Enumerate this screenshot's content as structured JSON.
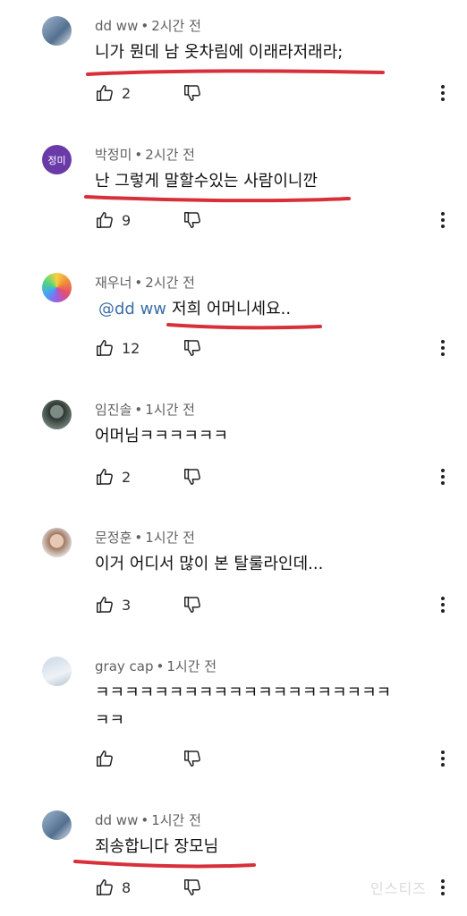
{
  "comments": [
    {
      "author": "dd ww",
      "time": "2시간 전",
      "text": "니가 뭔데 남 옷차림에 이래라저래라;",
      "mention": "",
      "likes": "2",
      "avatar": "photo-blue"
    },
    {
      "author": "박정미",
      "time": "2시간 전",
      "text": "난 그렇게 말할수있는 사람이니깐",
      "mention": "",
      "likes": "9",
      "avatar_initials": "정미"
    },
    {
      "author": "재우너",
      "time": "2시간 전",
      "text": "저희 어머니세요..",
      "mention": "@dd ww",
      "likes": "12",
      "avatar": "rainbow"
    },
    {
      "author": "임진솔",
      "time": "1시간 전",
      "text": "어머님ㅋㅋㅋㅋㅋㅋ",
      "mention": "",
      "likes": "2",
      "avatar": "photo-dark"
    },
    {
      "author": "문정훈",
      "time": "1시간 전",
      "text": "이거 어디서 많이 본 탈룰라인데...",
      "mention": "",
      "likes": "3",
      "avatar": "photo-face"
    },
    {
      "author": "gray cap",
      "time": "1시간 전",
      "text": "ㅋㅋㅋㅋㅋㅋㅋㅋㅋㅋㅋㅋㅋㅋㅋㅋㅋㅋㅋㅋ",
      "text2": "ㅋㅋ",
      "mention": "",
      "likes": "",
      "avatar": "photo-sky"
    },
    {
      "author": "dd ww",
      "time": "1시간 전",
      "text": "죄송합니다 장모님",
      "mention": "",
      "likes": "8",
      "avatar": "photo-blue"
    }
  ],
  "separator": "•",
  "icons": {
    "like": "thumbs-up-icon",
    "dislike": "thumbs-down-icon",
    "more": "more-vert-icon"
  },
  "colors": {
    "underline": "#d8303a",
    "mention": "#3b6ea8",
    "meta": "#606060"
  },
  "watermark": "인스티즈"
}
